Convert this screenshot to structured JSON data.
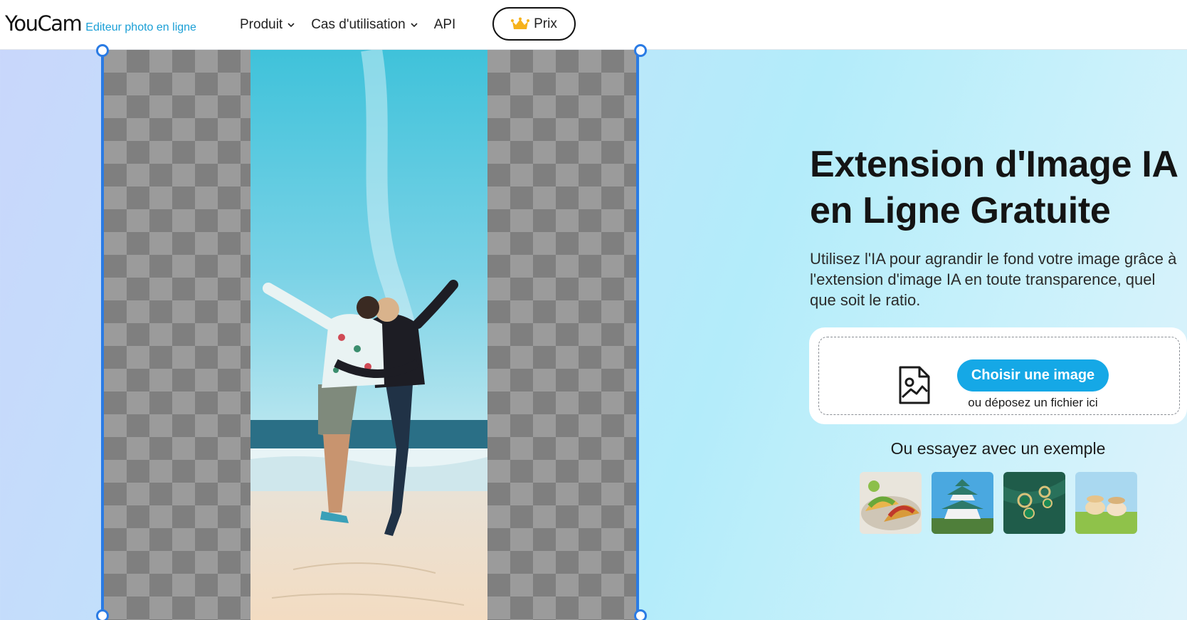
{
  "header": {
    "logo": "YouCam",
    "logo_subtitle": "Editeur photo en ligne",
    "nav": [
      {
        "label": "Produit",
        "icon": "chevron-down-icon"
      },
      {
        "label": "Cas d'utilisation",
        "icon": "chevron-down-icon"
      },
      {
        "label": "API"
      }
    ],
    "pricing_label": "Prix",
    "pricing_icon": "crown-icon"
  },
  "hero": {
    "title_line1": "Extension d'Image IA",
    "title_line2": "en Ligne Gratuite",
    "description": "Utilisez l'IA pour agrandir le fond votre image grâce à l'extension d'image IA en toute transparence, quel que soit le ratio."
  },
  "upload": {
    "icon": "image-file-icon",
    "button_label": "Choisir une image",
    "drop_text": "ou déposez un fichier ici"
  },
  "examples": {
    "title": "Ou essayez avec un exemple",
    "items": [
      "tacos",
      "japanese-castle",
      "emerald-earrings",
      "women-on-grass"
    ]
  },
  "colors": {
    "accent": "#15a8e6",
    "frame": "#2a7be4",
    "logo_subtitle": "#1a9fd6"
  }
}
